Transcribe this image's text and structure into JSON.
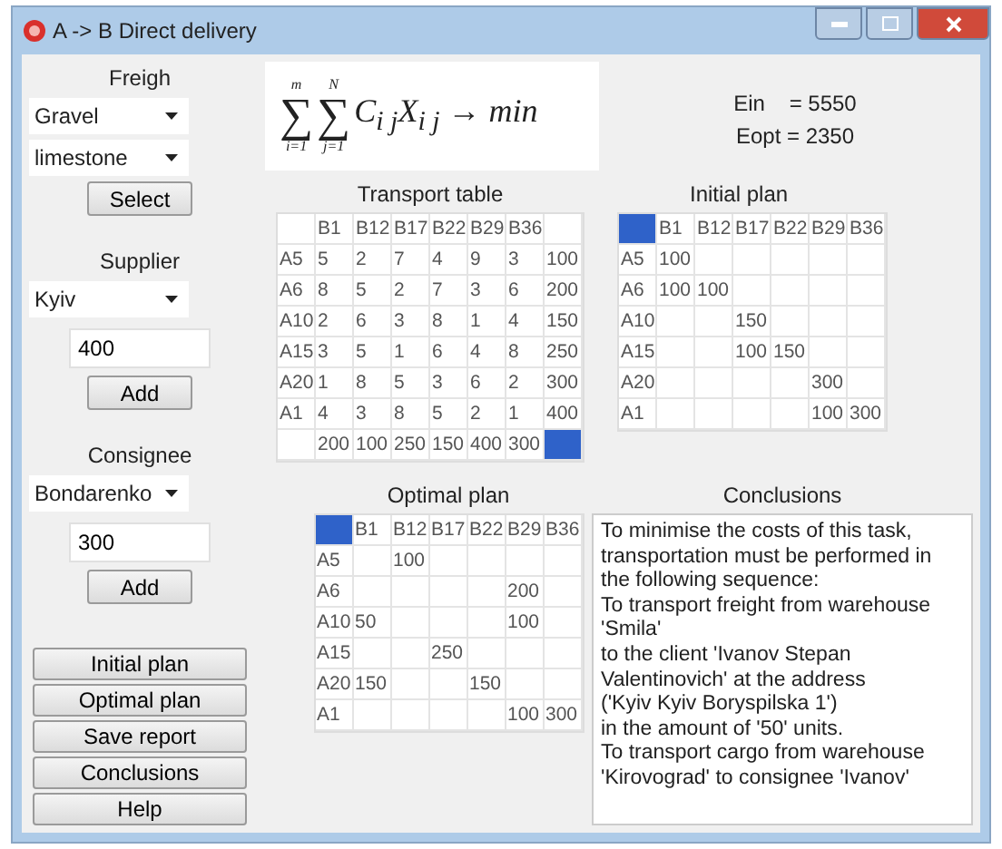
{
  "window": {
    "title": "A -> B Direct delivery"
  },
  "freight": {
    "label": "Freigh",
    "dropdowns": [
      "Gravel",
      "limestone"
    ],
    "button": "Select"
  },
  "supplier": {
    "label": "Supplier",
    "dropdown": "Kyiv",
    "value": "400",
    "button": "Add"
  },
  "consignee": {
    "label": "Consignee",
    "dropdown": "Bondarenko",
    "value": "300",
    "button": "Add"
  },
  "actions": [
    "Initial plan",
    "Optimal plan",
    "Save report",
    "Conclusions",
    "Help"
  ],
  "formula": {
    "sums": [
      {
        "sign": "∑",
        "upper": "m",
        "lower": "i=1"
      },
      {
        "sign": "∑",
        "upper": "N",
        "lower": "j=1"
      }
    ],
    "body": "C$_{i j}$X$_{i j}$ → min"
  },
  "results": [
    "Ein    = 5550",
    "Eopt = 2350"
  ],
  "transport_table": {
    "title": "Transport table",
    "corner_highlight": false,
    "end_highlight": true,
    "header": [
      "B1",
      "B12",
      "B17",
      "B22",
      "B29",
      "B36"
    ],
    "rows": [
      [
        "A5",
        "5",
        "2",
        "7",
        "4",
        "9",
        "3",
        "100"
      ],
      [
        "A6",
        "8",
        "5",
        "2",
        "7",
        "3",
        "6",
        "200"
      ],
      [
        "A10",
        "2",
        "6",
        "3",
        "8",
        "1",
        "4",
        "150"
      ],
      [
        "A15",
        "3",
        "5",
        "1",
        "6",
        "4",
        "8",
        "250"
      ],
      [
        "A20",
        "1",
        "8",
        "5",
        "3",
        "6",
        "2",
        "300"
      ],
      [
        "A1",
        "4",
        "3",
        "8",
        "5",
        "2",
        "1",
        "400"
      ],
      [
        null,
        "200",
        "100",
        "250",
        "150",
        "400",
        "300",
        null
      ]
    ]
  },
  "initial_plan": {
    "title": "Initial plan",
    "corner_highlight": true,
    "end_highlight": false,
    "header": [
      "B1",
      "B12",
      "B17",
      "B22",
      "B29",
      "B36"
    ],
    "rows": [
      [
        "A5",
        "100",
        null,
        null,
        null,
        null,
        null
      ],
      [
        "A6",
        "100",
        "100",
        null,
        null,
        null,
        null
      ],
      [
        "A10",
        null,
        null,
        "150",
        null,
        null,
        null
      ],
      [
        "A15",
        null,
        null,
        "100",
        "150",
        null,
        null
      ],
      [
        "A20",
        null,
        null,
        null,
        null,
        "300",
        null
      ],
      [
        "A1",
        null,
        null,
        null,
        null,
        "100",
        "300"
      ]
    ]
  },
  "optimal_plan": {
    "title": "Optimal plan",
    "corner_highlight": true,
    "end_highlight": false,
    "header": [
      "B1",
      "B12",
      "B17",
      "B22",
      "B29",
      "B36"
    ],
    "rows": [
      [
        "A5",
        null,
        "100",
        null,
        null,
        null,
        null
      ],
      [
        "A6",
        null,
        null,
        null,
        null,
        "200",
        null
      ],
      [
        "A10",
        "50",
        null,
        null,
        null,
        "100",
        null
      ],
      [
        "A15",
        null,
        null,
        "250",
        null,
        null,
        null
      ],
      [
        "A20",
        "150",
        null,
        null,
        "150",
        null,
        null
      ],
      [
        "A1",
        null,
        null,
        null,
        null,
        "100",
        "300"
      ]
    ]
  },
  "conclusions": {
    "label": "Conclusions",
    "lines": [
      "To minimise the costs of this task,",
      "transportation must be performed in",
      "the following sequence:",
      "To transport freight from warehouse",
      "'Smila'",
      "to the client 'Ivanov Stepan",
      "Valentinovich' at the address",
      "('Kyiv Kyiv Boryspilska 1')",
      "in the amount of '50' units.",
      "To transport cargo from warehouse",
      "'Kirovograd' to consignee 'Ivanov'"
    ]
  }
}
